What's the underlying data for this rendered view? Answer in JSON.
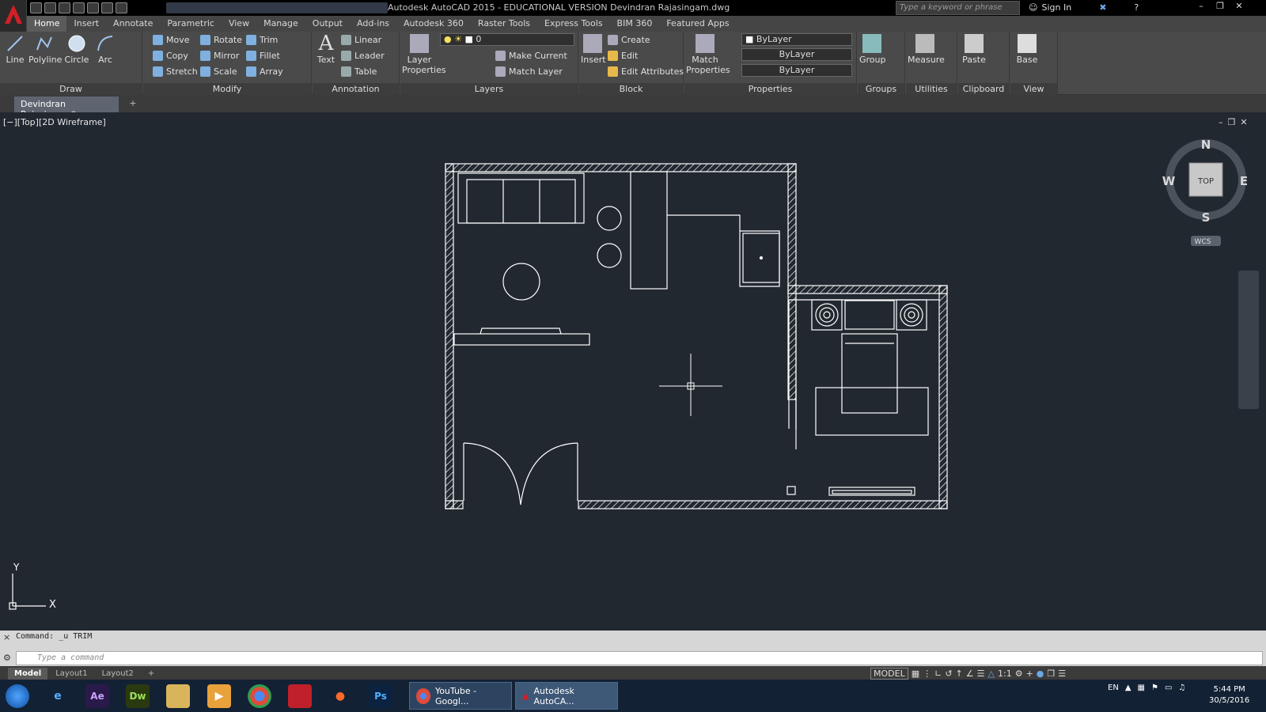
{
  "titlebar": {
    "title": "Autodesk AutoCAD 2015 - EDUCATIONAL VERSION   Devindran Rajasingam.dwg",
    "search_placeholder": "Type a keyword or phrase",
    "signin_label": "Sign In"
  },
  "ribbon_tabs": [
    "Home",
    "Insert",
    "Annotate",
    "Parametric",
    "View",
    "Manage",
    "Output",
    "Add-ins",
    "Autodesk 360",
    "Raster Tools",
    "Express Tools",
    "BIM 360",
    "Featured Apps"
  ],
  "draw": {
    "line": "Line",
    "polyline": "Polyline",
    "circle": "Circle",
    "arc": "Arc",
    "title": "Draw"
  },
  "modify": {
    "move": "Move",
    "rotate": "Rotate",
    "trim": "Trim",
    "copy": "Copy",
    "mirror": "Mirror",
    "fillet": "Fillet",
    "stretch": "Stretch",
    "scale": "Scale",
    "array": "Array",
    "title": "Modify"
  },
  "annotation": {
    "text": "Text",
    "linear": "Linear",
    "leader": "Leader",
    "table": "Table",
    "title": "Annotation"
  },
  "layers": {
    "layer_properties": "Layer Properties",
    "current_layer": "0",
    "make_current": "Make Current",
    "match_layer": "Match Layer",
    "title": "Layers"
  },
  "block": {
    "insert": "Insert",
    "create": "Create",
    "edit": "Edit",
    "edit_attributes": "Edit Attributes",
    "title": "Block"
  },
  "properties": {
    "match_properties": "Match Properties",
    "color": "ByLayer",
    "linetype": "ByLayer",
    "lineweight": "ByLayer",
    "title": "Properties"
  },
  "groups": {
    "group": "Group",
    "title": "Groups"
  },
  "utilities": {
    "measure": "Measure",
    "title": "Utilities"
  },
  "clipboard": {
    "paste": "Paste",
    "title": "Clipboard"
  },
  "view": {
    "base": "Base",
    "title": "View"
  },
  "document": {
    "tab_label": "Devindran Rajasingam*"
  },
  "viewport": {
    "label": "[−][Top][2D Wireframe]"
  },
  "viewcube": {
    "n": "N",
    "s": "S",
    "e": "E",
    "w": "W",
    "face": "TOP",
    "wcs": "WCS"
  },
  "ucs": {
    "x": "X",
    "y": "Y"
  },
  "command": {
    "history": "Command: _u TRIM",
    "placeholder": "Type a command"
  },
  "layout_tabs": [
    "Model",
    "Layout1",
    "Layout2"
  ],
  "status": {
    "model": "MODEL",
    "scale": "1:1"
  },
  "taskbar": {
    "apps": [
      "YouTube - Googl...",
      "Autodesk AutoCA..."
    ],
    "lang": "EN",
    "time": "5:44 PM",
    "date": "30/5/2016"
  }
}
